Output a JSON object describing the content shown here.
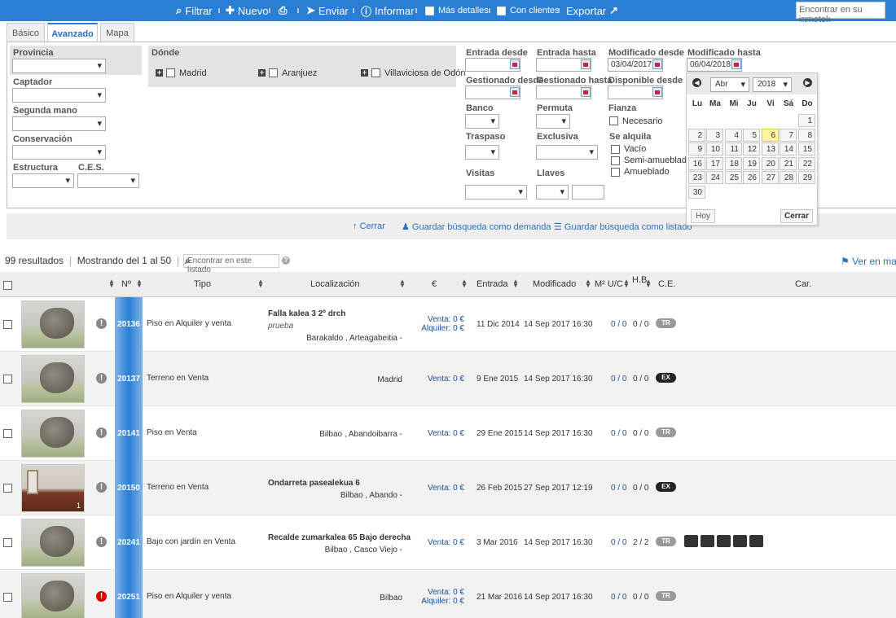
{
  "toolbar": {
    "filter": "Filtrar",
    "new": "Nuevo",
    "send": "Enviar",
    "inform": "Informar",
    "more_details": "Más detalles",
    "with_clients": "Con clientes",
    "export": "Exportar",
    "search_placeholder": "Encontrar en su inmotek"
  },
  "tabs": [
    "Básico",
    "Avanzado",
    "Mapa"
  ],
  "filters": {
    "provincia": "Provincia",
    "captador": "Captador",
    "segunda_mano": "Segunda mano",
    "conservacion": "Conservación",
    "estructura": "Estructura",
    "ces": "C.E.S.",
    "donde": "Dónde",
    "places": [
      "Madrid",
      "Aranjuez",
      "Villaviciosa de Odón"
    ],
    "entrada_desde": "Entrada desde",
    "entrada_hasta": "Entrada hasta",
    "modificado_desde": "Modificado desde",
    "modificado_desde_value": "03/04/2017",
    "modificado_hasta": "Modificado hasta",
    "modificado_hasta_value": "06/04/2018",
    "gestionado_desde": "Gestionado desde",
    "gestionado_hasta": "Gestionado hasta",
    "disponible_desde": "Disponible desde",
    "banco": "Banco",
    "permuta": "Permuta",
    "fianza": "Fianza",
    "necesario": "Necesario",
    "traspaso": "Traspaso",
    "exclusiva": "Exclusiva",
    "se_alquila": "Se alquila",
    "vacio": "Vacío",
    "semi": "Semi-amueblado",
    "amueblado": "Amueblado",
    "visitas": "Visitas",
    "llaves": "Llaves"
  },
  "calendar": {
    "month": "Abr",
    "year": "2018",
    "day_names": [
      "Lu",
      "Ma",
      "Mi",
      "Ju",
      "Vi",
      "Sá",
      "Do"
    ],
    "highlight": "6",
    "today": "Hoy",
    "close": "Cerrar"
  },
  "actions": {
    "close": "Cerrar",
    "save_demand": "Guardar búsqueda como demanda",
    "save_list": "Guardar búsqueda como listado"
  },
  "results": {
    "count": "99 resultados",
    "showing": "Mostrando del 1 al 50",
    "search_placeholder": "Encontrar en este listado",
    "map_link": "Ver en mapa"
  },
  "columns": {
    "num": "Nº",
    "tipo": "Tipo",
    "loc": "Localización",
    "eur": "€",
    "entrada": "Entrada",
    "modificado": "Modificado",
    "m2": "M² U/C",
    "hb": "H.B.",
    "ce": "C.E.",
    "car": "Car."
  },
  "rows": [
    {
      "id": "20136",
      "tipo": "Piso en Alquiler y venta",
      "title": "Falla kalea 3 2º drch",
      "note": "prueba",
      "loc": "Barakaldo , Arteagabeitia -",
      "venta": "Venta: 0 €",
      "alquiler": "Alquiler: 0 €",
      "entrada": "11 Dic 2014",
      "mod": "14 Sep 2017 16:30",
      "m2": "0 / 0",
      "hb": "0 / 0",
      "ce": "TR"
    },
    {
      "id": "20137",
      "tipo": "Terreno en Venta",
      "title": "",
      "note": "",
      "loc": "Madrid",
      "venta": "Venta: 0 €",
      "alquiler": "",
      "entrada": "9 Ene 2015",
      "mod": "14 Sep 2017 16:30",
      "m2": "0 / 0",
      "hb": "0 / 0",
      "ce": "EX"
    },
    {
      "id": "20141",
      "tipo": "Piso en Venta",
      "title": "",
      "note": "",
      "loc": "Bilbao , Abandoibarra -",
      "venta": "Venta: 0 €",
      "alquiler": "",
      "entrada": "29 Ene 2015",
      "mod": "14 Sep 2017 16:30",
      "m2": "0 / 0",
      "hb": "0 / 0",
      "ce": "TR"
    },
    {
      "id": "20150",
      "tipo": "Terreno en Venta",
      "title": "Ondarreta pasealekua 6",
      "note": "",
      "loc": "Bilbao , Abando -",
      "venta": "Venta: 0 €",
      "alquiler": "",
      "entrada": "26 Feb 2015",
      "mod": "27 Sep 2017 12:19",
      "m2": "0 / 0",
      "hb": "0 / 0",
      "ce": "EX",
      "photos": "1"
    },
    {
      "id": "20241",
      "tipo": "Bajo con jardín en Venta",
      "title": "Recalde zumarkalea 65 Bajo derecha",
      "note": "",
      "loc": "Bilbao , Casco Viejo -",
      "venta": "Venta: 0 €",
      "alquiler": "",
      "entrada": "3 Mar 2016",
      "mod": "14 Sep 2017 16:30",
      "m2": "0 / 0",
      "hb": "2 / 2",
      "ce": "TR"
    },
    {
      "id": "20251",
      "tipo": "Piso en Alquiler y venta",
      "title": "",
      "note": "",
      "loc": "Bilbao",
      "venta": "Venta: 0 €",
      "alquiler": "Alquiler: 0 €",
      "entrada": "21 Mar 2016",
      "mod": "14 Sep 2017 16:30",
      "m2": "0 / 0",
      "hb": "0 / 0",
      "ce": "TR"
    }
  ],
  "colors": {
    "toolbar": "#2a7ed3",
    "link": "#2a6fbe",
    "highlight": "#fcf59d"
  }
}
